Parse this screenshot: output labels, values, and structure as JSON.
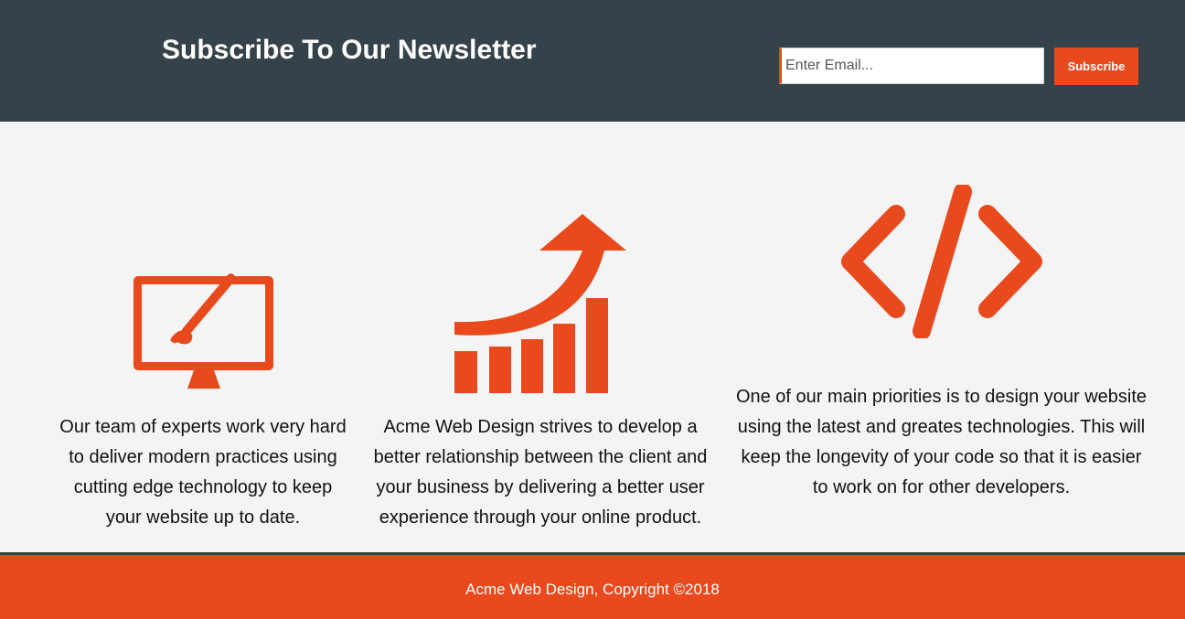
{
  "newsletter": {
    "heading": "Subscribe To Our Newsletter",
    "email_placeholder": "Enter Email...",
    "subscribe_label": "Subscribe"
  },
  "boxes": [
    {
      "icon": "monitor-brush-icon",
      "text": "Our team of experts work very hard to deliver modern practices using cutting edge technology to keep your website up to date."
    },
    {
      "icon": "growth-chart-icon",
      "text": "Acme Web Design strives to develop a better relationship between the client and your business by delivering a better user experience through your online product."
    },
    {
      "icon": "code-brackets-icon",
      "text": "One of our main priorities is to design your website using the latest and greates technologies. This will keep the longevity of your code so that it is easier to work on for other developers."
    }
  ],
  "footer": {
    "text": "Acme Web Design, Copyright ©2018"
  },
  "colors": {
    "dark": "#35424a",
    "accent": "#e8491d",
    "background": "#f4f4f4"
  }
}
